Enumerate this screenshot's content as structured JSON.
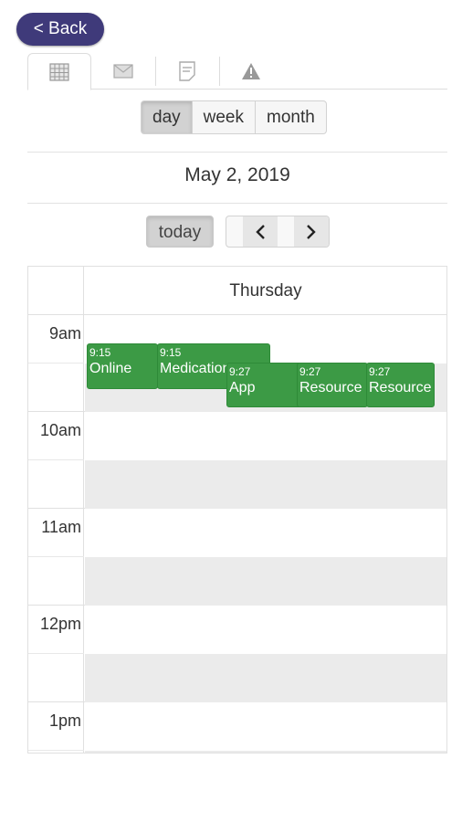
{
  "header": {
    "back_label": "< Back"
  },
  "tabs": [
    {
      "icon": "calendar-icon",
      "active": true
    },
    {
      "icon": "mail-icon",
      "active": false
    },
    {
      "icon": "notes-icon",
      "active": false
    },
    {
      "icon": "alert-icon",
      "active": false
    }
  ],
  "view_switcher": {
    "day": "day",
    "week": "week",
    "month": "month",
    "selected": "day"
  },
  "current_date": "May 2, 2019",
  "nav": {
    "today_label": "today",
    "prev_label": "<",
    "next_label": ">"
  },
  "calendar": {
    "day_header": "Thursday",
    "hours": [
      "9am",
      "10am",
      "11am",
      "12pm",
      "1pm"
    ],
    "events": [
      {
        "time": "9:15",
        "title": "Online"
      },
      {
        "time": "9:15",
        "title": "Medication"
      },
      {
        "time": "9:27",
        "title": "App"
      },
      {
        "time": "9:27",
        "title": "Resource"
      },
      {
        "time": "9:27",
        "title": "Resource"
      }
    ]
  },
  "colors": {
    "back_button": "#3f3a7a",
    "event": "#3c9a45",
    "shaded_slot": "#ebebeb"
  }
}
